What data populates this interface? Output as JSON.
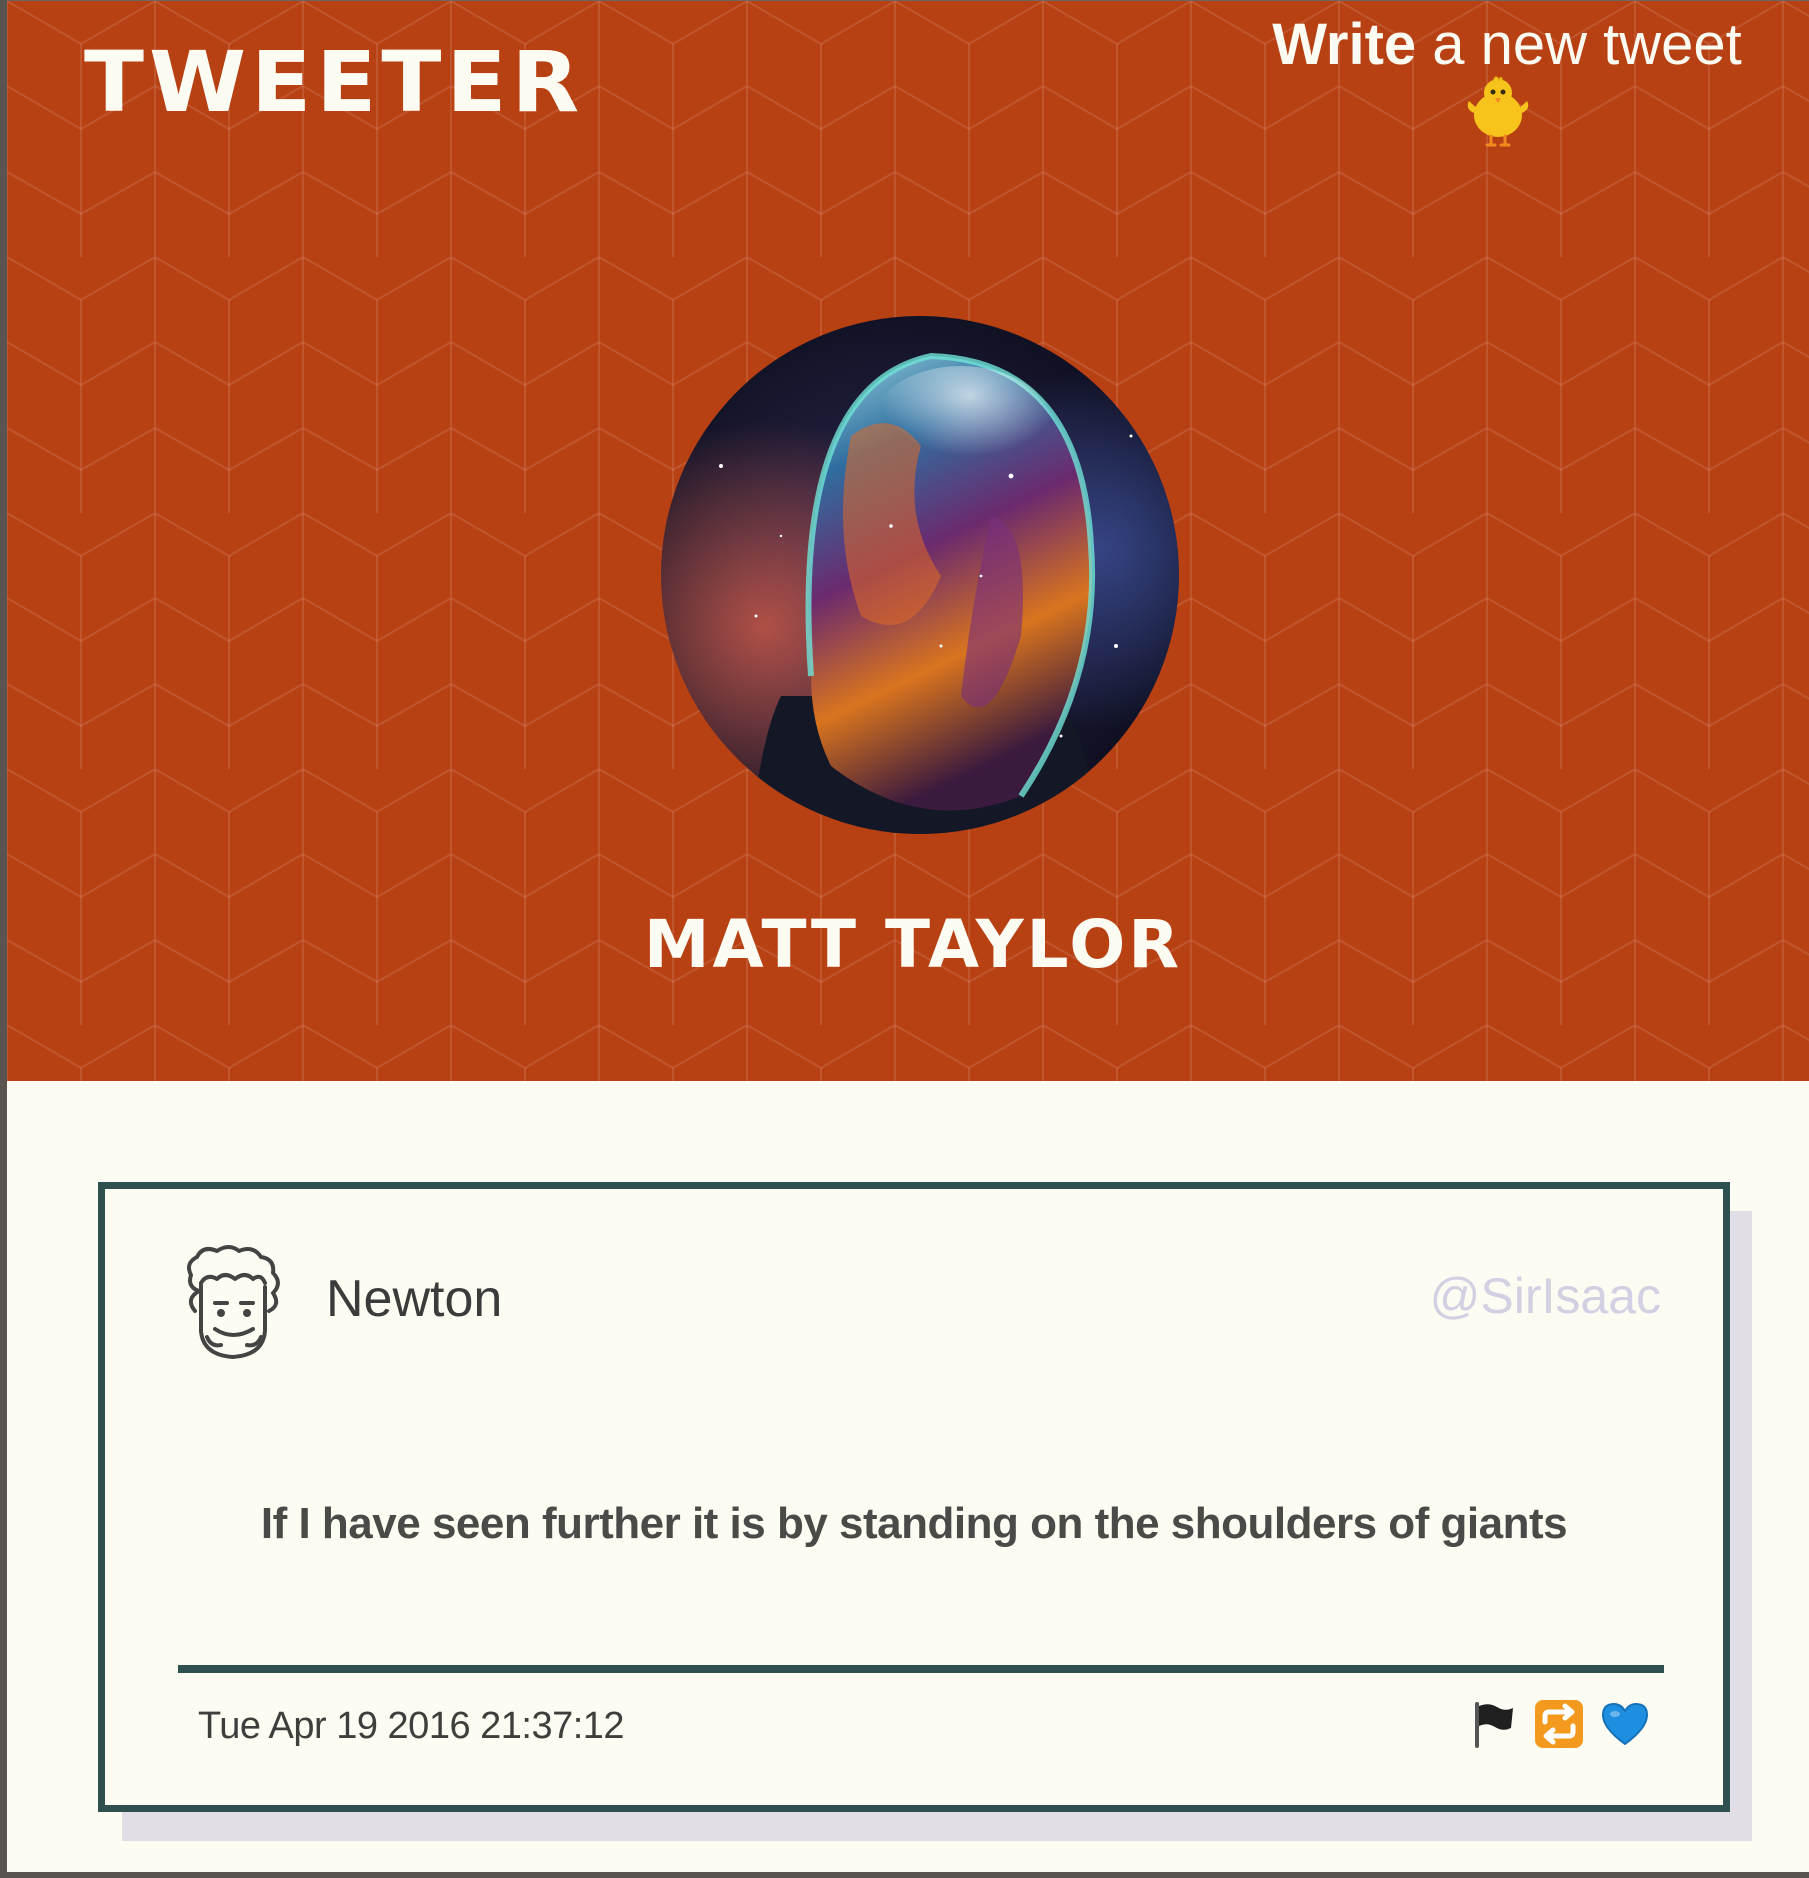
{
  "header": {
    "logo": "TWEETER",
    "compose": {
      "strong": "Write",
      "rest": " a new tweet",
      "icon": "hatching-chick-icon"
    },
    "profile": {
      "name": "MATT TAYLOR",
      "avatar": "cosmic-helmet-avatar"
    }
  },
  "tweet": {
    "author": "Newton",
    "handle": "@SirIsaac",
    "avatar": "curly-hair-face-avatar",
    "content": "If I have seen further it is by standing on the shoulders of giants",
    "timestamp": "Tue Apr 19 2016 21:37:12",
    "actions": [
      {
        "name": "flag-icon"
      },
      {
        "name": "retweet-icon"
      },
      {
        "name": "heart-icon"
      }
    ]
  },
  "colors": {
    "header_bg": "#b84114",
    "page_bg": "#fdfcf3",
    "accent": "#2e5150",
    "handle": "#d4d0e3",
    "shadow": "#e2dee6"
  }
}
